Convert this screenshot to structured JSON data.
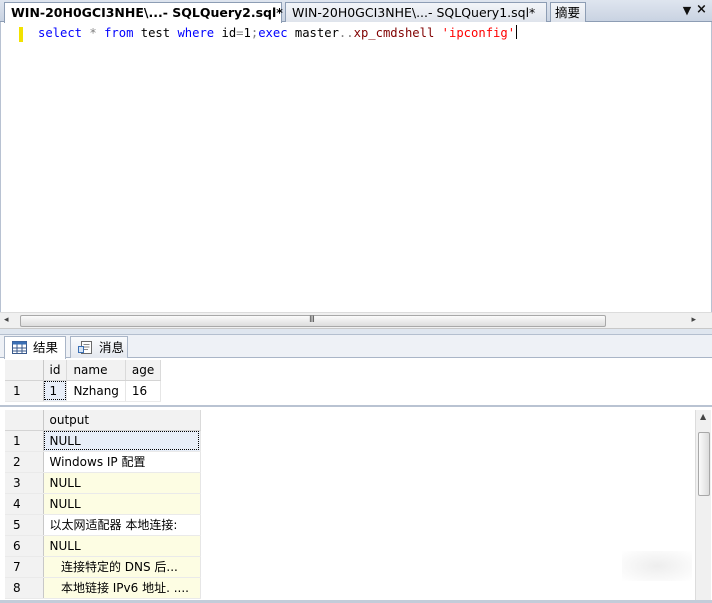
{
  "doc_tabs": [
    {
      "label": "WIN-20H0GCI3NHE\\...- SQLQuery2.sql*",
      "active": true
    },
    {
      "label": "WIN-20H0GCI3NHE\\...- SQLQuery1.sql*",
      "active": false
    },
    {
      "label": "摘要",
      "active": false
    }
  ],
  "tab_menu_glyph": "▼",
  "tab_close_glyph": "×",
  "editor": {
    "tokens": [
      {
        "t": "select",
        "c": "kw"
      },
      {
        "t": " ",
        "c": "id"
      },
      {
        "t": "*",
        "c": "op"
      },
      {
        "t": " ",
        "c": "id"
      },
      {
        "t": "from",
        "c": "kw"
      },
      {
        "t": " test ",
        "c": "id"
      },
      {
        "t": "where",
        "c": "kw"
      },
      {
        "t": " id",
        "c": "id"
      },
      {
        "t": "=",
        "c": "op"
      },
      {
        "t": "1",
        "c": "id"
      },
      {
        "t": ";",
        "c": "op"
      },
      {
        "t": "exec",
        "c": "kw"
      },
      {
        "t": " master",
        "c": "id"
      },
      {
        "t": "..",
        "c": "op"
      },
      {
        "t": "xp_cmdshell",
        "c": "sp"
      },
      {
        "t": " ",
        "c": "id"
      },
      {
        "t": "'ipconfig'",
        "c": "str"
      }
    ]
  },
  "hscroll": {
    "left_arrow": "◂",
    "right_arrow": "▸",
    "grip": "III"
  },
  "result_tabs": [
    {
      "label": "结果",
      "icon": "grid-icon",
      "active": true
    },
    {
      "label": "消息",
      "icon": "message-icon",
      "active": false
    }
  ],
  "grid1": {
    "columns": [
      "id",
      "name",
      "age"
    ],
    "rows": [
      {
        "num": "1",
        "cells": [
          "1",
          "Nzhang",
          "16"
        ]
      }
    ]
  },
  "grid2": {
    "columns": [
      "output"
    ],
    "rows": [
      {
        "num": "1",
        "value": "NULL"
      },
      {
        "num": "2",
        "value": "Windows IP 配置"
      },
      {
        "num": "3",
        "value": "NULL"
      },
      {
        "num": "4",
        "value": "NULL"
      },
      {
        "num": "5",
        "value": "以太网适配器 本地连接:"
      },
      {
        "num": "6",
        "value": "NULL"
      },
      {
        "num": "7",
        "value": "   连接特定的 DNS 后..."
      },
      {
        "num": "8",
        "value": "   本地链接 IPv6 地址. ...."
      }
    ]
  },
  "vscroll": {
    "up_arrow": "▲"
  }
}
